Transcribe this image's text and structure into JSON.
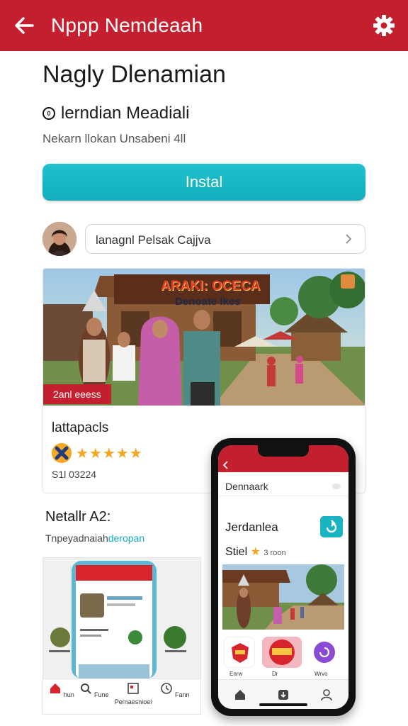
{
  "header": {
    "title": "Nppp Nemdeaah",
    "back_icon": "arrow-left-icon",
    "settings_icon": "gear-icon",
    "color": "#c41f2e"
  },
  "app": {
    "name": "Nagly Dlenamian",
    "developer": "lerndian Meadiali",
    "developer_badge": "0",
    "subtitle": "Nekarn llokan Unsabeni 4ll",
    "install_label": "Instal",
    "install_color": "#16b4c3"
  },
  "search": {
    "value": "lanagnl Pelsak Cajjva",
    "chevron_icon": "chevron-right-icon"
  },
  "featured": {
    "banner_title": "ARAKI: OCECA",
    "banner_subtitle": "Denoate lkes",
    "tag": "2anl eeess",
    "name": "lattapacls",
    "rating_icon": "rating-badge-icon",
    "stars": "★★★★★",
    "size": "S1l 03224"
  },
  "section2": {
    "title": "Netallr A2:",
    "subtitle_a": "Tnpeyadnaiah",
    "subtitle_b": "deropan"
  },
  "screenshot_nav": {
    "items": [
      {
        "label": "hun",
        "icon": "home-icon"
      },
      {
        "label": "Fune",
        "icon": "search-icon"
      },
      {
        "label": "Pernaesnioel",
        "icon": "news-icon"
      },
      {
        "label": "Fann",
        "icon": "clock-icon"
      }
    ]
  },
  "phone": {
    "search_text": "Dennaark",
    "title": "Jerdanlea",
    "sub_text": "Stiel",
    "sub_small": "3 roon",
    "label_a": "Enrw",
    "label_b": "Dr",
    "label_c": "Wrvo",
    "nav_icons": [
      "home-icon",
      "download-icon",
      "user-icon"
    ]
  }
}
